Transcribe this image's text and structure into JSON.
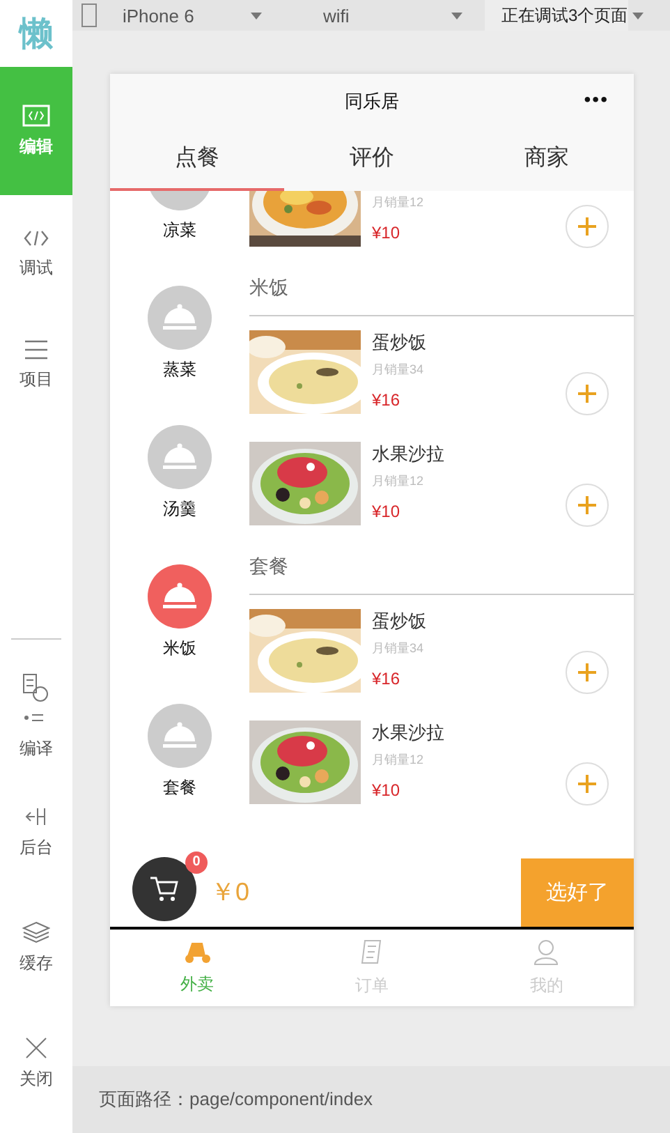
{
  "sidebar": {
    "logo": "懒",
    "items": [
      {
        "label": "编辑",
        "selected": true
      },
      {
        "label": "调试",
        "selected": false
      },
      {
        "label": "项目",
        "selected": false
      }
    ],
    "bottom_items": [
      {
        "label": "编译",
        "selected": false
      },
      {
        "label": "后台",
        "selected": false
      },
      {
        "label": "缓存",
        "selected": false
      },
      {
        "label": "关闭",
        "selected": false
      }
    ]
  },
  "toolbar": {
    "device": "iPhone 6",
    "network": "wifi",
    "debug": "正在调试3个页面"
  },
  "phone": {
    "title": "同乐居",
    "menu": "•••",
    "tabs": [
      {
        "label": "点餐",
        "selected": true
      },
      {
        "label": "评价",
        "selected": false
      },
      {
        "label": "商家",
        "selected": false
      }
    ],
    "categories": [
      {
        "label": "凉菜",
        "selected": false
      },
      {
        "label": "蒸菜",
        "selected": false
      },
      {
        "label": "汤羹",
        "selected": false
      },
      {
        "label": "米饭",
        "selected": true
      },
      {
        "label": "套餐",
        "selected": false
      }
    ],
    "sections": [
      {
        "dishes": [
          {
            "sales": "月销量12",
            "price": "¥10"
          }
        ]
      },
      {
        "title": "米饭",
        "dishes": [
          {
            "name": "蛋炒饭",
            "sales": "月销量34",
            "price": "¥16"
          },
          {
            "name": "水果沙拉",
            "sales": "月销量12",
            "price": "¥10"
          }
        ]
      },
      {
        "title": "套餐",
        "dishes": [
          {
            "name": "蛋炒饭",
            "sales": "月销量34",
            "price": "¥16"
          },
          {
            "name": "水果沙拉",
            "sales": "月销量12",
            "price": "¥10"
          }
        ]
      }
    ],
    "cart": {
      "count": "0",
      "total": "￥0",
      "checkout": "选好了"
    },
    "tabbar": [
      {
        "label": "外卖",
        "selected": true
      },
      {
        "label": "订单",
        "selected": false
      },
      {
        "label": "我的",
        "selected": false
      }
    ]
  },
  "path_bar": "页面路径：page/component/index"
}
